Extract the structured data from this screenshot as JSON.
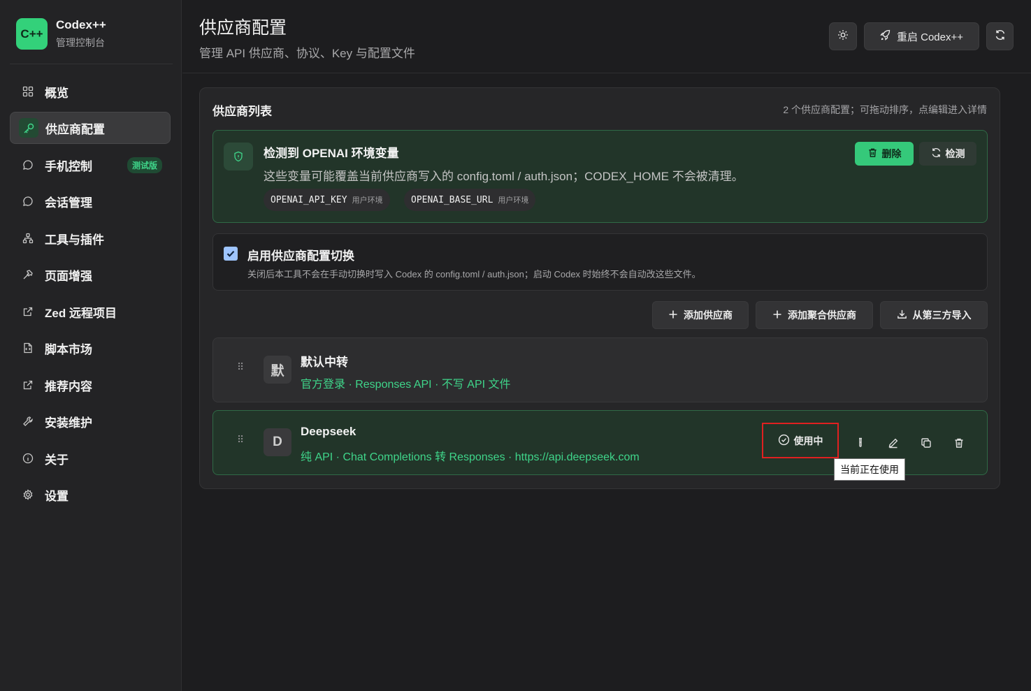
{
  "app": {
    "logo_text": "C++",
    "name": "Codex++",
    "subtitle": "管理控制台"
  },
  "sidebar": {
    "items": [
      {
        "label": "概览",
        "icon": "grid-icon",
        "active": false
      },
      {
        "label": "供应商配置",
        "icon": "key-icon",
        "active": true
      },
      {
        "label": "手机控制",
        "icon": "chat-bubble-icon",
        "active": false,
        "badge": "测试版"
      },
      {
        "label": "会话管理",
        "icon": "chat-bubble-icon",
        "active": false
      },
      {
        "label": "工具与插件",
        "icon": "network-icon",
        "active": false
      },
      {
        "label": "页面增强",
        "icon": "hammer-icon",
        "active": false
      },
      {
        "label": "Zed 远程项目",
        "icon": "external-link-icon",
        "active": false
      },
      {
        "label": "脚本市场",
        "icon": "file-code-icon",
        "active": false
      },
      {
        "label": "推荐内容",
        "icon": "external-link-icon",
        "active": false
      },
      {
        "label": "安装维护",
        "icon": "wrench-icon",
        "active": false
      },
      {
        "label": "关于",
        "icon": "info-icon",
        "active": false
      },
      {
        "label": "设置",
        "icon": "gear-icon",
        "active": false
      }
    ]
  },
  "header": {
    "title": "供应商配置",
    "subtitle": "管理 API 供应商、协议、Key 与配置文件",
    "restart_label": "重启 Codex++"
  },
  "panel": {
    "title": "供应商列表",
    "hint": "2 个供应商配置；可拖动排序，点编辑进入详情"
  },
  "env_alert": {
    "title": "检测到 OPENAI 环境变量",
    "description": "这些变量可能覆盖当前供应商写入的 config.toml / auth.json；CODEX_HOME 不会被清理。",
    "delete_label": "删除",
    "detect_label": "检测",
    "tags": [
      {
        "key": "OPENAI_API_KEY",
        "scope": "用户环境"
      },
      {
        "key": "OPENAI_BASE_URL",
        "scope": "用户环境"
      }
    ]
  },
  "switch_toggle": {
    "checked": true,
    "title": "启用供应商配置切换",
    "description": "关闭后本工具不会在手动切换时写入 Codex 的 config.toml / auth.json；启动 Codex 时始终不会自动改这些文件。"
  },
  "actions": {
    "add_provider": "添加供应商",
    "add_aggregate": "添加聚合供应商",
    "import_third_party": "从第三方导入"
  },
  "providers": [
    {
      "avatar": "默",
      "name": "默认中转",
      "description": "官方登录 · Responses API · 不写 API 文件",
      "in_use": false
    },
    {
      "avatar": "D",
      "name": "Deepseek",
      "description": "纯 API · Chat Completions 转 Responses · https://api.deepseek.com",
      "in_use": true,
      "in_use_label": "使用中"
    }
  ],
  "tooltip": "当前正在使用",
  "colors": {
    "accent": "#35c97a",
    "background": "#1d1d1f",
    "highlight_box": "#e02020"
  }
}
